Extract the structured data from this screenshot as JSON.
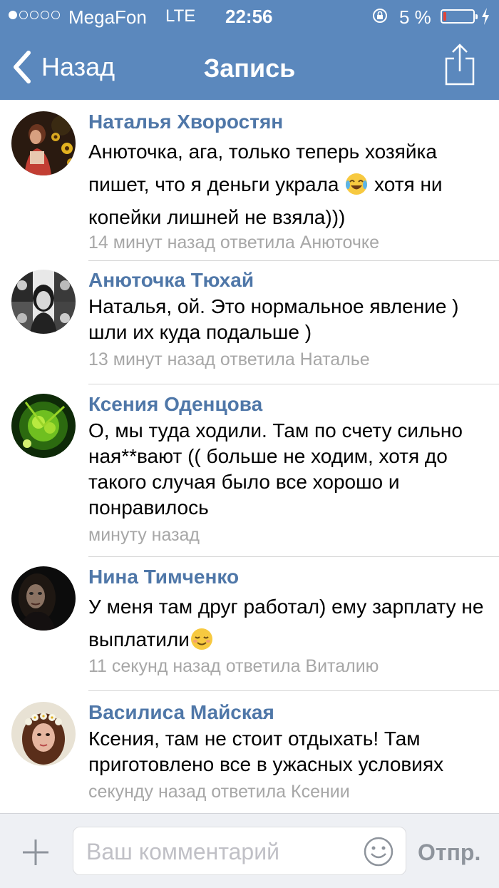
{
  "status_bar": {
    "carrier": "MegaFon",
    "network": "LTE",
    "time": "22:56",
    "battery_text": "5 %",
    "battery_level": 0.05,
    "signal_bars_filled": 1,
    "signal_bars_total": 5
  },
  "nav": {
    "back_label": "Назад",
    "title": "Запись",
    "share_icon": "share-icon"
  },
  "comments": [
    {
      "author": "Наталья Хворостян",
      "text_before_emoji": "Анюточка, ага, только теперь хозяйка пишет, что я деньги украла",
      "emoji": "crying-laughing-emoji",
      "text_after_emoji": "хотя ни копейки лишней не взяла)))",
      "meta": "14 минут назад ответила Анюточке"
    },
    {
      "author": "Анюточка Тюхай",
      "text": "Наталья, ой. Это нормальное явление ) шли их куда подальше )",
      "meta": "13 минут назад ответила Наталье"
    },
    {
      "author": "Ксения Оденцова",
      "text": "О, мы туда ходили. Там по счету сильно ная**вают (( больше не ходим, хотя до такого случая было все хорошо и  понравилось",
      "meta": "минуту назад"
    },
    {
      "author": "Нина Тимченко",
      "text": "У меня там друг работал) ему зарплату не выплатили",
      "emoji": "relieved-face-emoji",
      "meta": "11 секунд назад ответила Виталию"
    },
    {
      "author": "Василиса Майская",
      "text": "Ксения, там не стоит отдыхать! Там приготовлено все в ужасных условиях",
      "meta": "секунду назад ответила Ксении"
    }
  ],
  "composer": {
    "placeholder": "Ваш комментарий",
    "send_label": "Отпр.",
    "colors": {
      "accent": "#5b88bd",
      "name": "#4f77a8"
    }
  }
}
